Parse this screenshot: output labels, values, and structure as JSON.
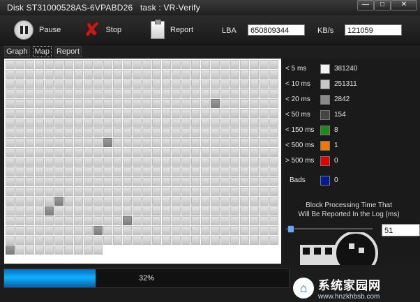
{
  "window": {
    "title": "Disk ST31000528AS-6VPABD26   task : VR-Verify"
  },
  "toolbar": {
    "pause_label": "Pause",
    "stop_label": "Stop",
    "report_label": "Report",
    "lba_label": "LBA",
    "lba_value": "650809344",
    "kbs_label": "KB/s",
    "kbs_value": "121059"
  },
  "tabs": [
    "Graph",
    "Map",
    "Report"
  ],
  "active_tab": "Map",
  "legend": [
    {
      "label": "< 5 ms",
      "count": "381240",
      "color": "#f2f2f2"
    },
    {
      "label": "< 10 ms",
      "count": "251311",
      "color": "#c8c8c8"
    },
    {
      "label": "< 20 ms",
      "count": "2842",
      "color": "#8a8a8a"
    },
    {
      "label": "< 50 ms",
      "count": "154",
      "color": "#444444"
    },
    {
      "label": "< 150 ms",
      "count": "8",
      "color": "#1e8a1e"
    },
    {
      "label": "< 500 ms",
      "count": "1",
      "color": "#f07800"
    },
    {
      "label": "> 500 ms",
      "count": "0",
      "color": "#e00000"
    },
    {
      "label": "Bads",
      "count": "0",
      "color": "#001a99"
    }
  ],
  "block_note": {
    "line1": "Block Processing Time That",
    "line2": "Will Be Reported In the Log (ms)"
  },
  "slider_value": "51",
  "progress": {
    "percent_text": "32%",
    "fraction": 0.32
  },
  "watermark": {
    "name": "系统家园网",
    "url": "www.hnzkhbsb.com"
  }
}
